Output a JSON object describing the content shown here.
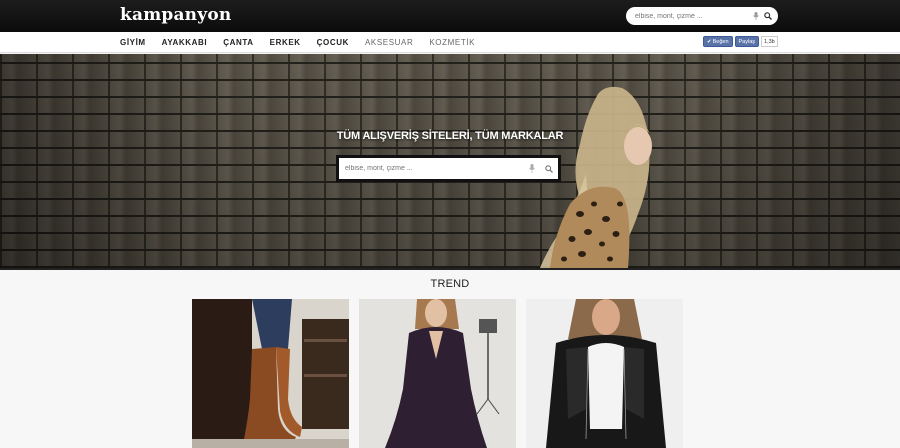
{
  "header": {
    "logo": "kampanyon",
    "search_placeholder": "elbise, mont, çizme ..."
  },
  "nav": {
    "items": [
      "GİYİM",
      "AYAKKABI",
      "ÇANTA",
      "ERKEK",
      "ÇOCUK",
      "AKSESUAR",
      "KOZMETİK"
    ]
  },
  "social": {
    "like_label": "Beğen",
    "share_label": "Paylaş",
    "count": "1,3b"
  },
  "hero": {
    "title": "TÜM ALIŞVERİŞ SİTELERİ, TÜM MARKALAR",
    "search_placeholder": "elbise, mont, çizme ..."
  },
  "trend": {
    "title": "TREND",
    "cards": [
      {
        "icon": "boots-photo"
      },
      {
        "icon": "dress-photo"
      },
      {
        "icon": "leather-jacket-photo"
      }
    ]
  },
  "colors": {
    "topbar": "#111111",
    "facebook": "#5973a8",
    "hero_search_frame": "#111111"
  }
}
